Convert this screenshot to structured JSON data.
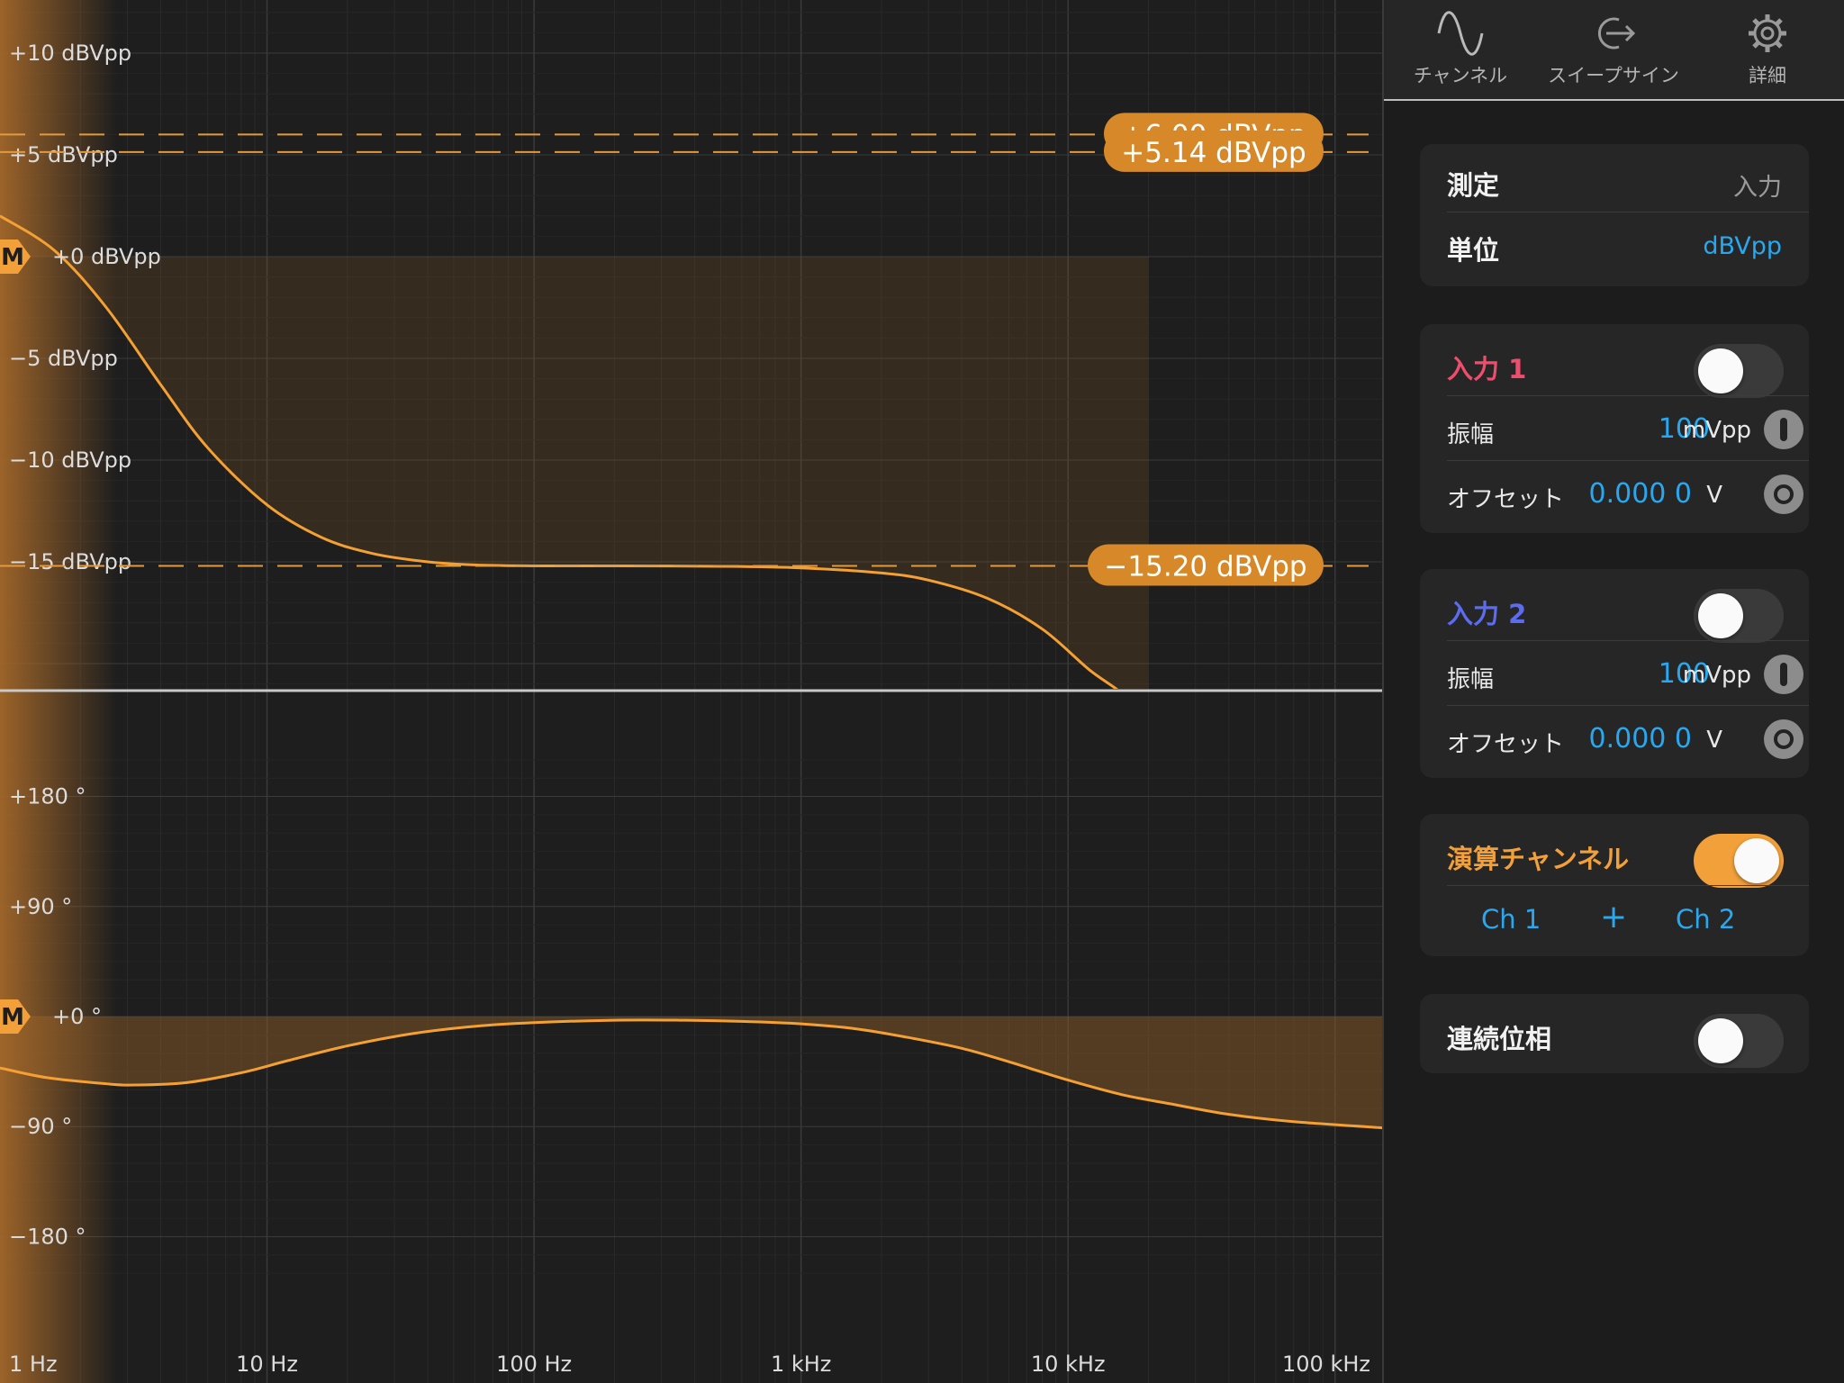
{
  "tabs": [
    {
      "label": "チャンネル",
      "icon": "sine-wave-icon"
    },
    {
      "label": "スイープサイン",
      "icon": "sweep-arrow-icon"
    },
    {
      "label": "詳細",
      "icon": "gear-icon"
    }
  ],
  "settings": {
    "measure_label": "測定",
    "measure_value": "入力",
    "unit_label": "単位",
    "unit_value": "dBVpp"
  },
  "input1": {
    "title": "入力 1",
    "title_color": "#ef4d6d",
    "enabled": false,
    "amplitude_label": "振幅",
    "amplitude_value": "100",
    "amplitude_unit": "mVpp",
    "offset_label": "オフセット",
    "offset_value": "0.000 0",
    "offset_unit": "V"
  },
  "input2": {
    "title": "入力 2",
    "title_color": "#5b6cf0",
    "enabled": false,
    "amplitude_label": "振幅",
    "amplitude_value": "100",
    "amplitude_unit": "mVpp",
    "offset_label": "オフセット",
    "offset_value": "0.000 0",
    "offset_unit": "V"
  },
  "math": {
    "title": "演算チャンネル",
    "enabled": true,
    "operand1": "Ch 1",
    "operator": "+",
    "operand2": "Ch 2"
  },
  "continuous_phase": {
    "label": "連続位相",
    "enabled": false
  },
  "colors": {
    "trace": "#f5a033",
    "accent_blue": "#29a8ef",
    "cursor_badge": "#d7892a"
  },
  "chart_data": [
    {
      "type": "line",
      "name": "magnitude",
      "x_scale": "log",
      "xlim": [
        1,
        150000
      ],
      "ylim": [
        -21,
        12
      ],
      "y_ticks": [
        {
          "value": 10,
          "label": "+10 dBVpp"
        },
        {
          "value": 5,
          "label": "+5 dBVpp"
        },
        {
          "value": 0,
          "label": "+0 dBVpp"
        },
        {
          "value": -5,
          "label": "−5 dBVpp"
        },
        {
          "value": -10,
          "label": "−10 dBVpp"
        },
        {
          "value": -15,
          "label": "−15 dBVpp"
        }
      ],
      "marker": {
        "label": "M",
        "value": 0
      },
      "cursors": [
        {
          "value": 6.0,
          "label": "+6.00 dBVpp"
        },
        {
          "value": 5.14,
          "label": "+5.14 dBVpp"
        },
        {
          "value": -15.2,
          "label": "−15.20 dBVpp"
        }
      ],
      "x": [
        1,
        1.6,
        2.5,
        4,
        6,
        10,
        16,
        25,
        40,
        60,
        100,
        200,
        500,
        1000,
        2000,
        3000,
        5000,
        8000,
        12000,
        16000,
        20000
      ],
      "y": [
        2.0,
        0.3,
        -2.5,
        -6.3,
        -9.4,
        -12.2,
        -13.8,
        -14.6,
        -15.0,
        -15.15,
        -15.2,
        -15.2,
        -15.22,
        -15.3,
        -15.55,
        -15.9,
        -16.8,
        -18.3,
        -20.3,
        -21.5,
        -23.0
      ]
    },
    {
      "type": "line",
      "name": "phase",
      "x_scale": "log",
      "xlim": [
        1,
        150000
      ],
      "ylim": [
        -220,
        220
      ],
      "y_ticks": [
        {
          "value": 180,
          "label": "+180 °"
        },
        {
          "value": 90,
          "label": "+90 °"
        },
        {
          "value": 0,
          "label": "+0 °"
        },
        {
          "value": -90,
          "label": "−90 °"
        },
        {
          "value": -180,
          "label": "−180 °"
        }
      ],
      "marker": {
        "label": "M",
        "value": 0
      },
      "x_ticks": [
        {
          "value": 1,
          "label": "1 Hz"
        },
        {
          "value": 10,
          "label": "10 Hz"
        },
        {
          "value": 100,
          "label": "100 Hz"
        },
        {
          "value": 1000,
          "label": "1 kHz"
        },
        {
          "value": 10000,
          "label": "10 kHz"
        },
        {
          "value": 100000,
          "label": "100 kHz"
        }
      ],
      "x": [
        1,
        1.5,
        2.5,
        3.2,
        5,
        8,
        12,
        20,
        35,
        60,
        100,
        200,
        350,
        600,
        1000,
        1600,
        2500,
        4000,
        6000,
        10000,
        16000,
        25000,
        40000,
        70000,
        150000
      ],
      "y": [
        -42,
        -50,
        -55,
        -56,
        -54,
        -46,
        -36,
        -24,
        -14,
        -8,
        -5,
        -3,
        -3,
        -4,
        -6,
        -10,
        -17,
        -26,
        -37,
        -52,
        -64,
        -72,
        -80,
        -86,
        -91
      ]
    }
  ]
}
